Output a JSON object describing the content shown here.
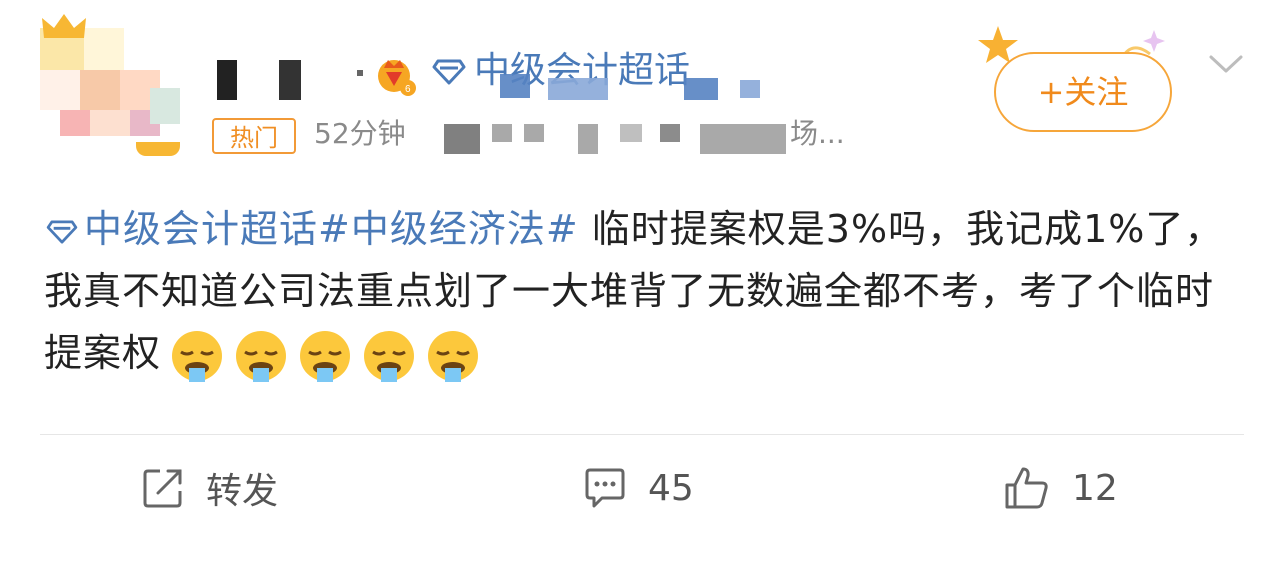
{
  "header": {
    "topic_label": "中级会计超话",
    "hot_tag": "热门",
    "time_label": "52分钟",
    "source_tail": "场...",
    "follow_label": "+关注"
  },
  "post": {
    "tag1": "中级会计超话",
    "tag2": "#中级经济法#",
    "text": " 临时提案权是3%吗，我记成1%了，我真不知道公司法重点划了一大堆背了无数遍全都不考，考了个临时提案权",
    "emoji_count": 5
  },
  "actions": {
    "repost_label": "转发",
    "comment_count": "45",
    "like_count": "12"
  },
  "colors": {
    "link_blue": "#4a7ab8",
    "orange": "#f08a1c",
    "gray_text": "#8a8a8a"
  }
}
